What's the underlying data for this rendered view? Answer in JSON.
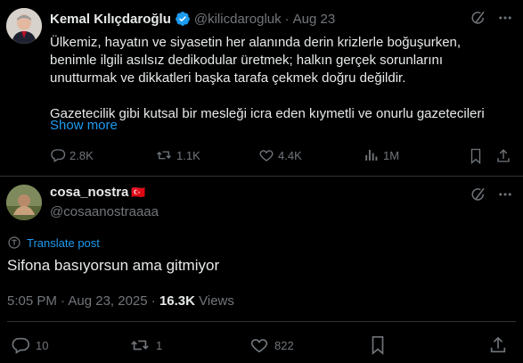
{
  "main_post": {
    "author_name": "Kemal Kılıçdaroğlu",
    "handle": "@kilicdarogluk",
    "separator": "·",
    "date": "Aug 23",
    "text_lines": [
      "Ülkemiz, hayatın ve siyasetin her alanında derin krizlerle boğuşurken,",
      "benimle ilgili asılsız dedikodular üretmek; halkın gerçek sorunlarını",
      "unutturmak ve dikkatleri başka tarafa çekmek doğru değildir.",
      "",
      "Gazetecilik gibi kutsal bir mesleği icra eden kıymetli ve onurlu gazetecileri"
    ],
    "show_more": "Show more",
    "stats": {
      "replies": "2.8K",
      "reposts": "1.1K",
      "likes": "4.4K",
      "views": "1M"
    }
  },
  "reply": {
    "author_name": "cosa_nostra",
    "flag": "🇹🇷",
    "handle": "@cosaanostraaaa",
    "translate": "Translate post",
    "text": "Sifona basıyorsun ama gitmiyor",
    "meta": {
      "time_date": "5:05 PM · Aug 23, 2025 · ",
      "views_count": "16.3K",
      "views_label": " Views"
    },
    "stats": {
      "replies": "10",
      "reposts": "1",
      "likes": "822"
    }
  },
  "colors": {
    "background": "#000000",
    "text": "#e7e9ea",
    "muted": "#71767b",
    "accent": "#1d9bf0",
    "divider": "#2f3336"
  },
  "icons": [
    "verified-badge-icon",
    "grok-icon",
    "more-icon",
    "reply-icon",
    "repost-icon",
    "like-icon",
    "views-icon",
    "bookmark-icon",
    "share-icon",
    "translate-icon"
  ]
}
